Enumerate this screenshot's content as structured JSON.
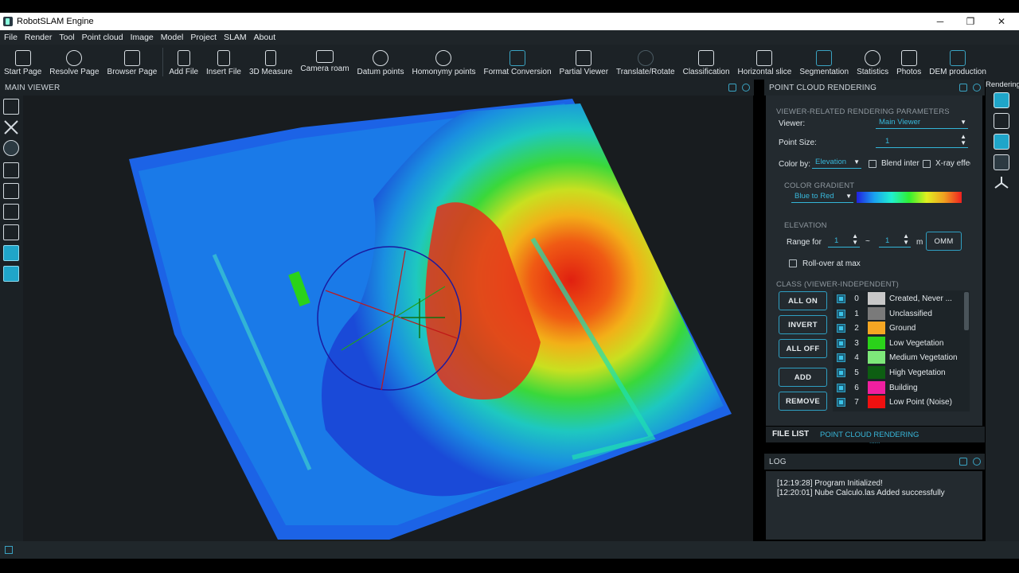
{
  "window": {
    "title": "RobotSLAM Engine",
    "minimize": "─",
    "maximize": "❐",
    "close": "✕"
  },
  "menu": [
    "File",
    "Render",
    "Tool",
    "Point cloud",
    "Image",
    "Model",
    "Project",
    "SLAM",
    "About"
  ],
  "toolbar": [
    "Start Page",
    "Resolve Page",
    "Browser Page",
    "Add File",
    "Insert File",
    "3D Measure",
    "Camera roam",
    "Datum points",
    "Homonymy points",
    "Format Conversion",
    "Partial Viewer",
    "Translate/Rotate",
    "Classification",
    "Horizontal slice",
    "Segmentation",
    "Statistics",
    "Photos",
    "DEM production"
  ],
  "main_viewer": {
    "title": "MAIN VIEWER"
  },
  "rendering_panel": {
    "title": "POINT CLOUD RENDERING",
    "viewer_params_label": "VIEWER-RELATED RENDERING PARAMETERS",
    "viewer_label": "Viewer:",
    "viewer_value": "Main Viewer",
    "point_size_label": "Point Size:",
    "point_size_value": "1",
    "color_by_label": "Color by:",
    "color_by_value": "Elevation",
    "blend_label": "Blend inter",
    "xray_label": "X-ray effec",
    "gradient_section": "COLOR GRADIENT",
    "gradient_value": "Blue to Red",
    "elevation_section": "ELEVATION",
    "range_label": "Range for (",
    "range_min": "1",
    "range_sep": "~",
    "range_max": "1",
    "range_unit": "m",
    "omm_label": "OMM",
    "rollover_label": "Roll-over at max",
    "class_section": "CLASS (VIEWER-INDEPENDENT)",
    "buttons": {
      "all_on": "ALL ON",
      "invert": "INVERT",
      "all_off": "ALL OFF",
      "add": "ADD",
      "remove": "REMOVE"
    },
    "classes": [
      {
        "num": "0",
        "name": "Created, Never ...",
        "color": "#c8c8c8"
      },
      {
        "num": "1",
        "name": "Unclassified",
        "color": "#7a7a7a"
      },
      {
        "num": "2",
        "name": "Ground",
        "color": "#f5a623"
      },
      {
        "num": "3",
        "name": "Low Vegetation",
        "color": "#2ad21a"
      },
      {
        "num": "4",
        "name": "Medium Vegetation",
        "color": "#7ee87a"
      },
      {
        "num": "5",
        "name": "High Vegetation",
        "color": "#0d5e12"
      },
      {
        "num": "6",
        "name": "Building",
        "color": "#f01fa0"
      },
      {
        "num": "7",
        "name": "Low Point (Noise)",
        "color": "#f01010"
      }
    ]
  },
  "tabs": {
    "file_list": "FILE LIST",
    "point_cloud_rendering": "POINT CLOUD RENDERING",
    "dots": "......"
  },
  "log": {
    "title": "LOG",
    "lines": [
      "[12:19:28] Program Initialized!",
      "[12:20:01] Nube Calculo.las Added successfully"
    ]
  },
  "rendering_rail": {
    "title": "Rendering",
    "icons": [
      "layers-icon",
      "tree-icon",
      "cube-icon",
      "brush-icon",
      "axis-icon"
    ]
  },
  "colors": {
    "accent": "#2f9fc2",
    "background": "#232a2f"
  }
}
